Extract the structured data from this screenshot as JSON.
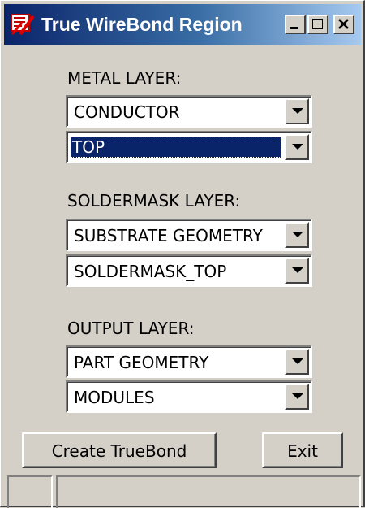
{
  "window": {
    "title": "True WireBond Region",
    "icon": "app-logo-icon",
    "controls": [
      "minimize-icon",
      "maximize-icon",
      "close-icon"
    ]
  },
  "metal": {
    "label": "METAL LAYER:",
    "class_value": "CONDUCTOR",
    "subclass_value": "TOP"
  },
  "soldermask": {
    "label": "SOLDERMASK LAYER:",
    "class_value": "SUBSTRATE GEOMETRY",
    "subclass_value": "SOLDERMASK_TOP"
  },
  "output": {
    "label": "OUTPUT LAYER:",
    "class_value": "PART GEOMETRY",
    "subclass_value": "MODULES"
  },
  "buttons": {
    "create_label": "Create TrueBond",
    "exit_label": "Exit"
  },
  "colors": {
    "face": "#d4d0c8",
    "title_active": "#0a246a",
    "selection": "#0a246a"
  }
}
